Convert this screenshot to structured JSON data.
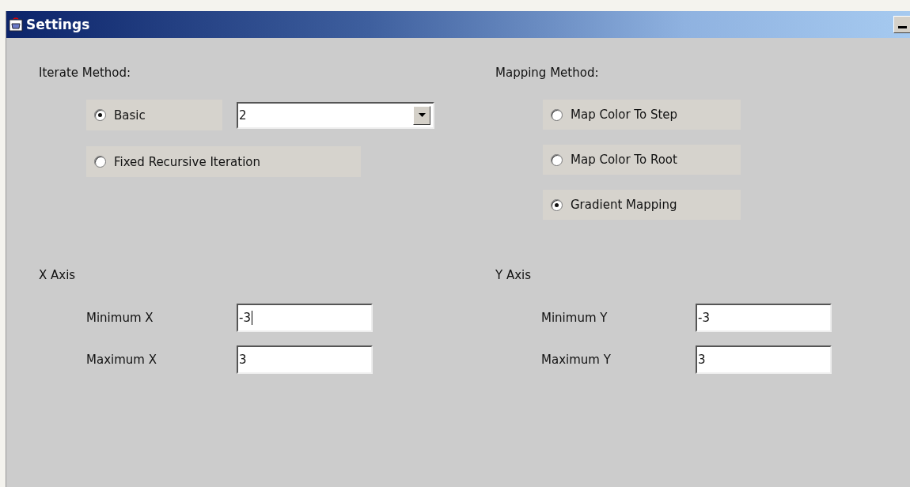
{
  "window": {
    "title": "Settings"
  },
  "iterate": {
    "heading": "Iterate Method:",
    "options": [
      {
        "label": "Basic",
        "selected": true
      },
      {
        "label": "Fixed Recursive Iteration",
        "selected": false
      }
    ],
    "combo": {
      "value": "2"
    }
  },
  "mapping": {
    "heading": "Mapping Method:",
    "options": [
      {
        "label": "Map Color To Step",
        "selected": false
      },
      {
        "label": "Map Color To Root",
        "selected": false
      },
      {
        "label": "Gradient Mapping",
        "selected": true
      }
    ]
  },
  "axes": [
    {
      "heading": "X Axis",
      "fields": [
        {
          "label": "Minimum X",
          "value": "-3",
          "focused": true
        },
        {
          "label": "Maximum X",
          "value": "3",
          "focused": false
        }
      ]
    },
    {
      "heading": "Y Axis",
      "fields": [
        {
          "label": "Minimum Y",
          "value": "-3",
          "focused": false
        },
        {
          "label": "Maximum Y",
          "value": "3",
          "focused": false
        }
      ]
    }
  ]
}
